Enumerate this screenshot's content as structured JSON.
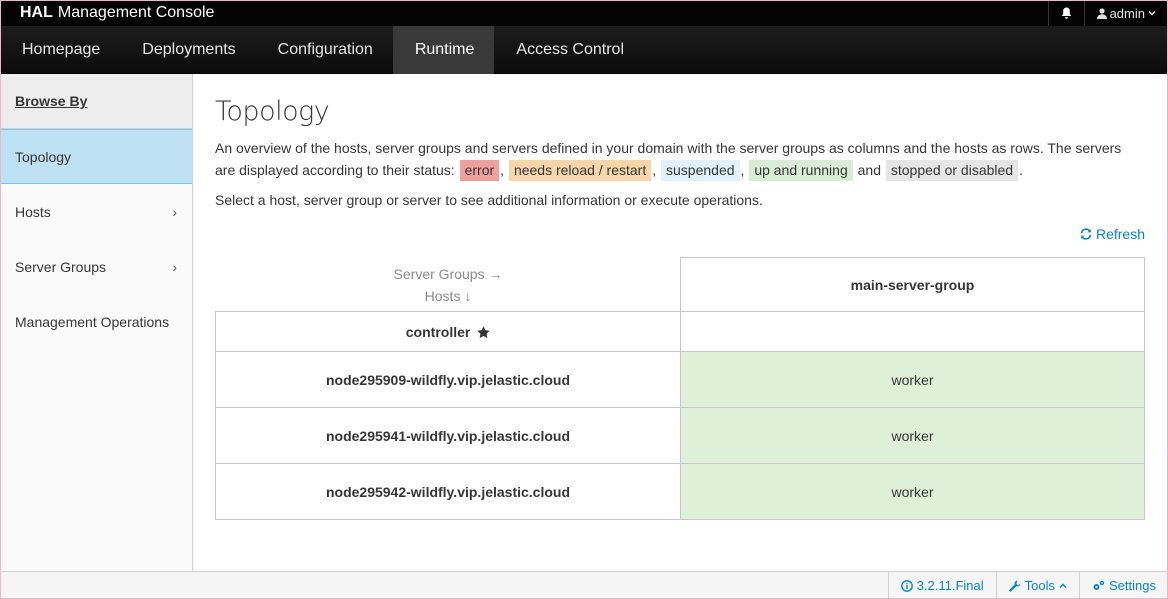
{
  "header": {
    "brand_bold": "HAL",
    "brand_rest": "Management Console",
    "user": "admin"
  },
  "nav": [
    "Homepage",
    "Deployments",
    "Configuration",
    "Runtime",
    "Access Control"
  ],
  "sidebar": {
    "heading": "Browse By",
    "items": [
      {
        "label": "Topology"
      },
      {
        "label": "Hosts"
      },
      {
        "label": "Server Groups"
      },
      {
        "label": "Management Operations"
      }
    ]
  },
  "main": {
    "title": "Topology",
    "desc_part1": "An overview of the hosts, server groups and servers defined in your domain with the server groups as columns and the hosts as rows. The servers are displayed according to their status:",
    "status_tags": [
      "error",
      "needs reload / restart",
      "suspended",
      "up and running",
      "stopped or disabled"
    ],
    "and_word": "and",
    "select_text": "Select a host, server group or server to see additional information or execute operations.",
    "refresh_label": "Refresh",
    "table": {
      "corner_groups": "Server Groups →",
      "corner_hosts": "Hosts ↓",
      "group": "main-server-group",
      "controller": "controller",
      "hosts": [
        {
          "name": "node295909-wildfly.vip.jelastic.cloud",
          "server": "worker"
        },
        {
          "name": "node295941-wildfly.vip.jelastic.cloud",
          "server": "worker"
        },
        {
          "name": "node295942-wildfly.vip.jelastic.cloud",
          "server": "worker"
        }
      ]
    }
  },
  "footer": {
    "version": "3.2.11.Final",
    "tools": "Tools",
    "settings": "Settings"
  },
  "colors": {
    "accent": "#0088ce",
    "running": "#dff0d8",
    "error": "#f09f9f"
  }
}
